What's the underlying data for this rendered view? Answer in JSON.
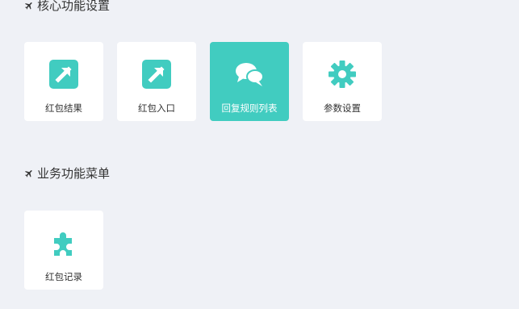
{
  "colors": {
    "background": "#eff1f6",
    "accent": "#41ccc0",
    "tile": "#ffffff",
    "text": "#333333"
  },
  "sections": [
    {
      "title": "核心功能设置",
      "icon": "airplane-icon",
      "tiles": [
        {
          "label": "红包结果",
          "icon": "external-link-arrow-icon",
          "active": false
        },
        {
          "label": "红包入口",
          "icon": "external-link-arrow-icon",
          "active": false
        },
        {
          "label": "回复规则列表",
          "icon": "chat-bubbles-icon",
          "active": true
        },
        {
          "label": "参数设置",
          "icon": "gear-icon",
          "active": false
        }
      ]
    },
    {
      "title": "业务功能菜单",
      "icon": "airplane-icon",
      "tiles": [
        {
          "label": "红包记录",
          "icon": "puzzle-piece-icon",
          "active": false
        }
      ]
    }
  ]
}
